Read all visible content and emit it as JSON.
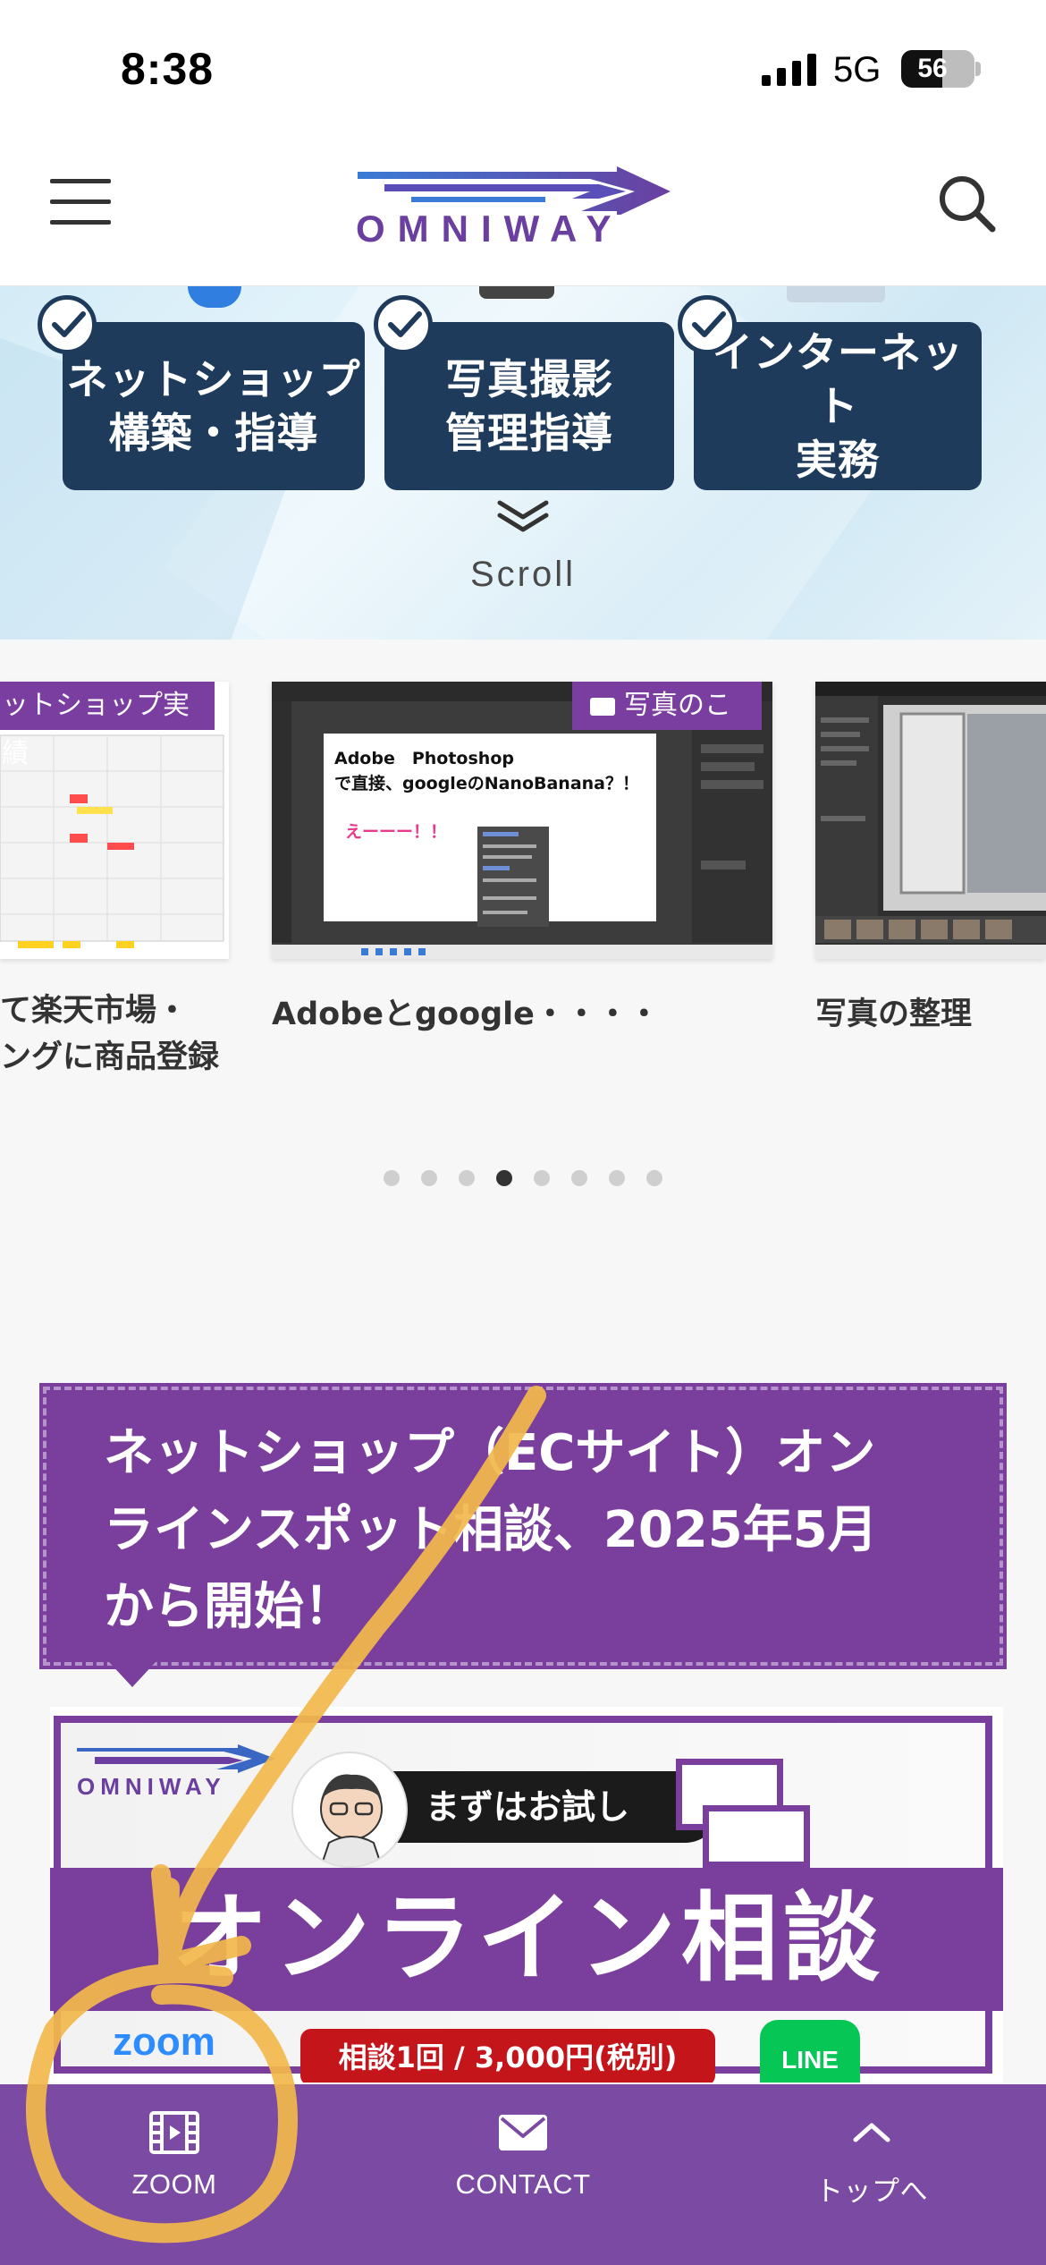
{
  "status_bar": {
    "time": "8:38",
    "network": "5G",
    "battery_level": 56,
    "battery_text": "56"
  },
  "header": {
    "logo_text": "OMNIWAY",
    "menu_icon": "hamburger-menu-icon",
    "search_icon": "search-icon"
  },
  "hero": {
    "services": [
      {
        "line1": "ネットショップ",
        "line2": "構築・指導"
      },
      {
        "line1": "写真撮影",
        "line2": "管理指導"
      },
      {
        "line1": "インターネット",
        "line2": "実務"
      }
    ],
    "scroll_label": "Scroll"
  },
  "carousel": {
    "slides": [
      {
        "category": "ットショップ実績",
        "title_line1": "て楽天市場・",
        "title_line2": "ングに商品登録"
      },
      {
        "category": "写真のこと",
        "title": "Adobeとgoogle・・・・",
        "image_text_1": "Adobe　Photoshop",
        "image_text_2": "で直接、googleのNanoBanana？！",
        "image_text_3": "えーーー！！"
      },
      {
        "title": "写真の整理"
      }
    ],
    "dot_count": 8,
    "active_dot": 3
  },
  "article": {
    "title_line1": "ネットショップ（ECサイト）オン",
    "title_line2": "ラインスポット相談、2025年5月",
    "title_line3": "から開始！",
    "banner": {
      "logo_text": "OMNIWAY",
      "trial_text": "まずはお試し",
      "headline": "オンライン相談",
      "zoom_text": "zoom",
      "price_text": "相談1回 / 3,000円(税別)",
      "line_text": "LINE"
    }
  },
  "bottom_nav": {
    "items": [
      {
        "label": "ZOOM",
        "icon": "film-icon"
      },
      {
        "label": "CONTACT",
        "icon": "mail-icon"
      },
      {
        "label": "トップへ",
        "icon": "chevron-up-icon"
      }
    ]
  },
  "colors": {
    "brand_purple": "#7a3f9c",
    "nav_purple": "#7b4aa3",
    "service_navy": "#1f3b5c",
    "annotation_orange": "#f2b84b"
  }
}
